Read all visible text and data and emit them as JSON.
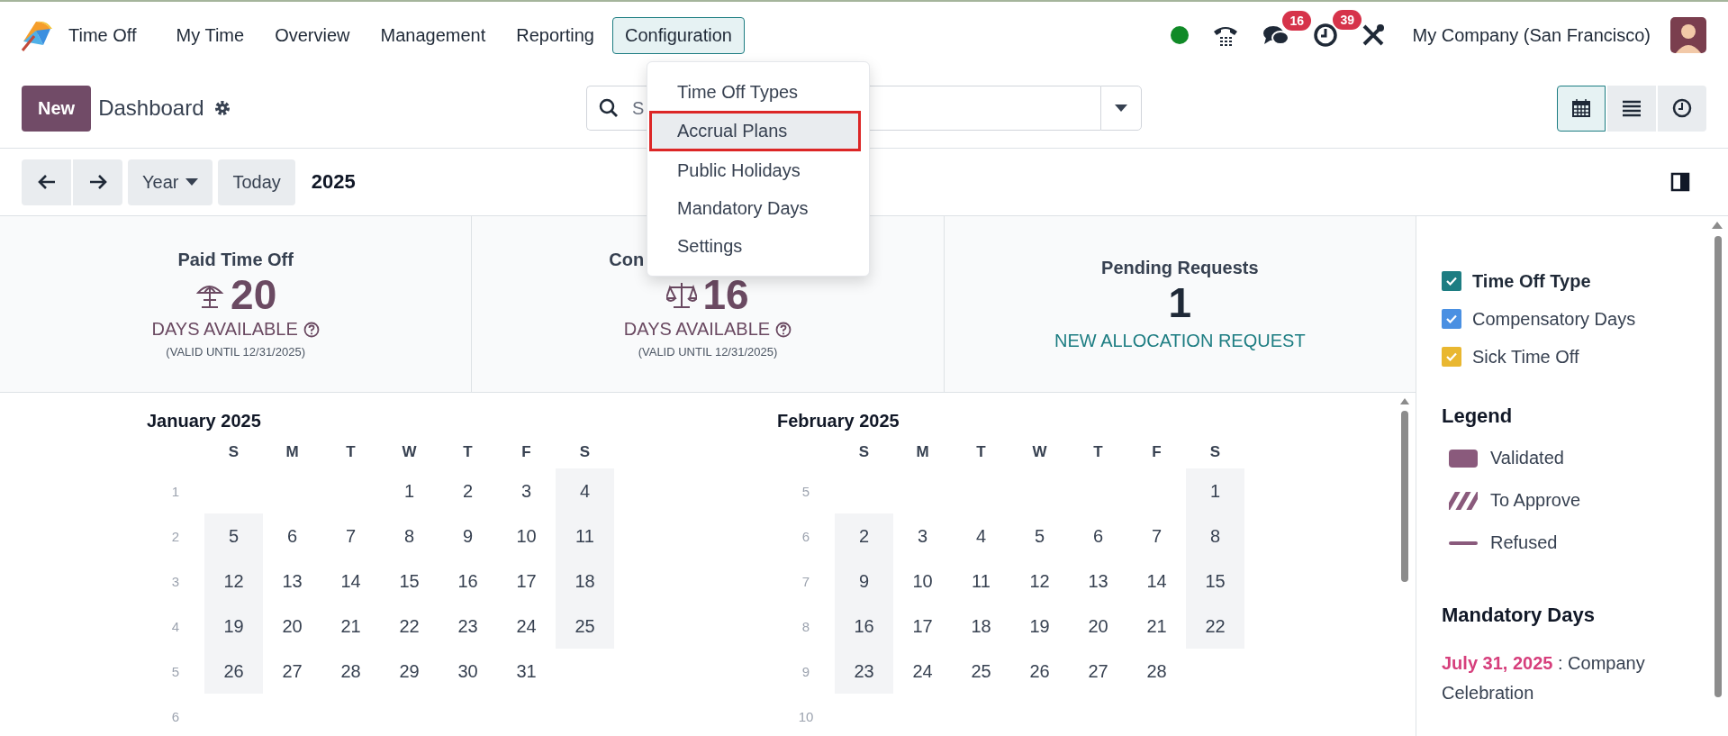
{
  "navbar": {
    "app_name": "Time Off",
    "menus": [
      {
        "label": "My Time",
        "selected": false
      },
      {
        "label": "Overview",
        "selected": false
      },
      {
        "label": "Management",
        "selected": false
      },
      {
        "label": "Reporting",
        "selected": false
      },
      {
        "label": "Configuration",
        "selected": true
      }
    ],
    "messages_badge": "16",
    "activities_badge": "39",
    "company": "My Company (San Francisco)"
  },
  "config_menu": {
    "items": [
      {
        "label": "Time Off Types",
        "selected": false
      },
      {
        "label": "Accrual Plans",
        "selected": true
      },
      {
        "label": "Public Holidays",
        "selected": false
      },
      {
        "label": "Mandatory Days",
        "selected": false
      },
      {
        "label": "Settings",
        "selected": false
      }
    ]
  },
  "control_panel": {
    "new_button": "New",
    "breadcrumb": "Dashboard",
    "search": {
      "placeholder": "S"
    },
    "views": [
      {
        "kind": "calendar",
        "selected": true
      },
      {
        "kind": "list",
        "selected": false
      },
      {
        "kind": "activity",
        "selected": false
      }
    ]
  },
  "calendar_nav": {
    "scale": "Year",
    "today": "Today",
    "period": "2025"
  },
  "cards": [
    {
      "kind": "allocation",
      "title": "Paid Time Off",
      "value": "20",
      "unit": "DAYS AVAILABLE",
      "validity": "(VALID UNTIL 12/31/2025)"
    },
    {
      "kind": "allocation",
      "title": "Con",
      "value": "16",
      "unit": "DAYS AVAILABLE",
      "validity": "(VALID UNTIL 12/31/2025)"
    },
    {
      "kind": "pending",
      "title": "Pending Requests",
      "value": "1",
      "link": "NEW ALLOCATION REQUEST"
    }
  ],
  "months": [
    {
      "title": "January 2025",
      "weekdays": [
        "S",
        "M",
        "T",
        "W",
        "T",
        "F",
        "S"
      ],
      "weeks": [
        {
          "number": "1",
          "days": [
            "1",
            "2",
            "3",
            "4"
          ]
        },
        {
          "number": "2",
          "days": [
            "5",
            "6",
            "7",
            "8",
            "9",
            "10",
            "11"
          ]
        },
        {
          "number": "3",
          "days": [
            "12",
            "13",
            "14",
            "15",
            "16",
            "17",
            "18"
          ]
        },
        {
          "number": "4",
          "days": [
            "19",
            "20",
            "21",
            "22",
            "23",
            "24",
            "25"
          ]
        },
        {
          "number": "5",
          "days": [
            "26",
            "27",
            "28",
            "29",
            "30",
            "31"
          ]
        },
        {
          "number": "6"
        }
      ]
    },
    {
      "title": "February 2025",
      "weekdays": [
        "S",
        "M",
        "T",
        "W",
        "T",
        "F",
        "S"
      ],
      "weeks": [
        {
          "number": "5",
          "days": [
            "1"
          ]
        },
        {
          "number": "6",
          "days": [
            "2",
            "3",
            "4",
            "5",
            "6",
            "7",
            "8"
          ]
        },
        {
          "number": "7",
          "days": [
            "9",
            "10",
            "11",
            "12",
            "13",
            "14",
            "15"
          ]
        },
        {
          "number": "8",
          "days": [
            "16",
            "17",
            "18",
            "19",
            "20",
            "21",
            "22"
          ]
        },
        {
          "number": "9",
          "days": [
            "23",
            "24",
            "25",
            "26",
            "27",
            "28"
          ]
        },
        {
          "number": "10"
        }
      ]
    }
  ],
  "side": {
    "group": {
      "label": "Time Off Type",
      "checked": true,
      "color": "#1d7d82"
    },
    "filters": [
      {
        "label": "Compensatory Days",
        "checked": true,
        "color": "#4a90e2"
      },
      {
        "label": "Sick Time Off",
        "checked": true,
        "color": "#e9b730"
      }
    ],
    "legend_title": "Legend",
    "legend": [
      {
        "kind": "validated",
        "label": "Validated"
      },
      {
        "kind": "to_approve",
        "label": "To Approve"
      },
      {
        "kind": "refused",
        "label": "Refused"
      }
    ],
    "mandatory_title": "Mandatory Days",
    "mandatory": [
      "**July 31, 2025** : Company Celebration"
    ]
  }
}
